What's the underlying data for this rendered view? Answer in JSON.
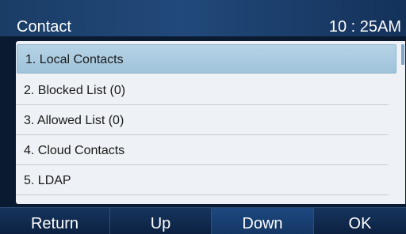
{
  "header": {
    "title": "Contact",
    "time": "10 : 25AM"
  },
  "menu": {
    "items": [
      {
        "label": "1. Local Contacts",
        "selected": true
      },
      {
        "label": "2. Blocked List (0)",
        "selected": false
      },
      {
        "label": "3. Allowed List (0)",
        "selected": false
      },
      {
        "label": "4. Cloud Contacts",
        "selected": false
      },
      {
        "label": "5. LDAP",
        "selected": false
      }
    ]
  },
  "softkeys": {
    "return_label": "Return",
    "up_label": "Up",
    "down_label": "Down",
    "ok_label": "OK"
  },
  "colors": {
    "header_bg": "#1a3d66",
    "panel_bg": "#eef1f5",
    "selected_bg": "#a9cbe0",
    "softkey_bg": "#0d2240"
  }
}
